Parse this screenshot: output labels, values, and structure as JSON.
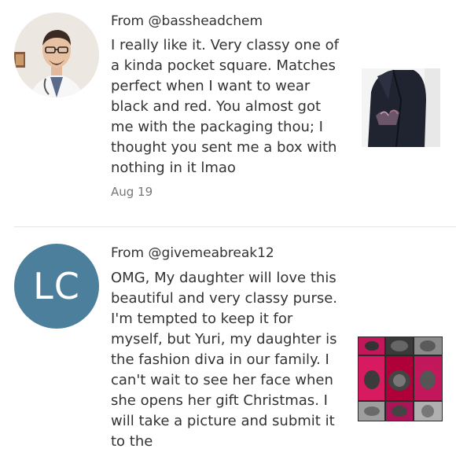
{
  "reviews": [
    {
      "author": "From @bassheadchem",
      "text": "I really like it. Very classy one of a kinda pocket square. Matches perfect when I want to wear black and red. You almost got me with the packaging thou; I thought you sent me a box with nothing in it lmao",
      "date": "Aug 19",
      "avatar_type": "photo",
      "photo_subject": "pocket-square-on-blazer"
    },
    {
      "author": "From @givemeabreak12",
      "text": "OMG, My daughter will love this beautiful and very classy purse. I'm tempted to keep it for myself, but Yuri, my daughter is the fashion diva in our family. I can't wait to see her face when she opens her gift Christmas. I will take a picture and submit it to the",
      "avatar_type": "initials",
      "avatar_initials": "LC",
      "avatar_color": "#4b7f9b",
      "photo_subject": "purse-collage"
    }
  ]
}
